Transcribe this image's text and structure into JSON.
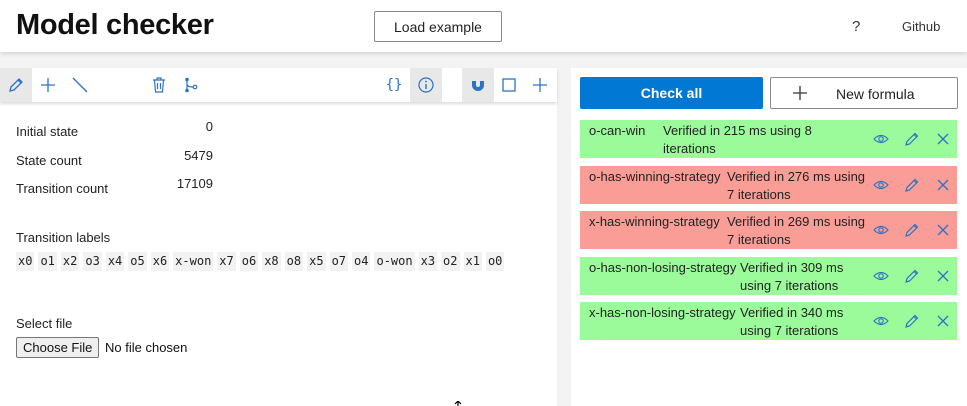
{
  "header": {
    "title": "Model checker",
    "load_example_label": "Load example",
    "help_label": "?",
    "github_label": "Github"
  },
  "toolbar": {
    "icons": [
      "pencil-icon",
      "plus-icon",
      "line-icon",
      "trash-icon",
      "branch-icon",
      "braces-icon",
      "info-icon",
      "magnet-icon",
      "square-icon",
      "plus-icon"
    ],
    "braces_label": "{}",
    "active": [
      "pencil",
      "info",
      "magnet"
    ]
  },
  "stats": {
    "initial_state": {
      "label": "Initial state",
      "value": "0"
    },
    "state_count": {
      "label": "State count",
      "value": "5479"
    },
    "transition_count": {
      "label": "Transition count",
      "value": "17109"
    }
  },
  "transition_labels": {
    "heading": "Transition labels",
    "items": [
      "x0",
      "o1",
      "x2",
      "o3",
      "x4",
      "o5",
      "x6",
      "x-won",
      "x7",
      "o6",
      "x8",
      "o8",
      "x5",
      "o7",
      "o4",
      "o-won",
      "x3",
      "o2",
      "x1",
      "o0"
    ]
  },
  "file": {
    "heading": "Select file",
    "button_label": "Choose File",
    "status": "No file chosen"
  },
  "formulas_panel": {
    "check_all_label": "Check all",
    "new_formula_label": "New formula",
    "formulas": [
      {
        "name": "o-can-win",
        "status": "Verified in 215 ms using 8 iterations",
        "result": "ok"
      },
      {
        "name": "o-has-winning-strategy",
        "status": "Verified in 276 ms using 7 iterations",
        "result": "fail"
      },
      {
        "name": "x-has-winning-strategy",
        "status": "Verified in 269 ms using 7 iterations",
        "result": "fail"
      },
      {
        "name": "o-has-non-losing-strategy",
        "status": "Verified in 309 ms using 7 iterations",
        "result": "ok"
      },
      {
        "name": "x-has-non-losing-strategy",
        "status": "Verified in 340 ms using 7 iterations",
        "result": "ok"
      }
    ]
  },
  "colors": {
    "accent": "#0078d4",
    "verified_true": "#9bfb9b",
    "verified_false": "#fa9d96",
    "icon_blue": "#2b73c6"
  }
}
